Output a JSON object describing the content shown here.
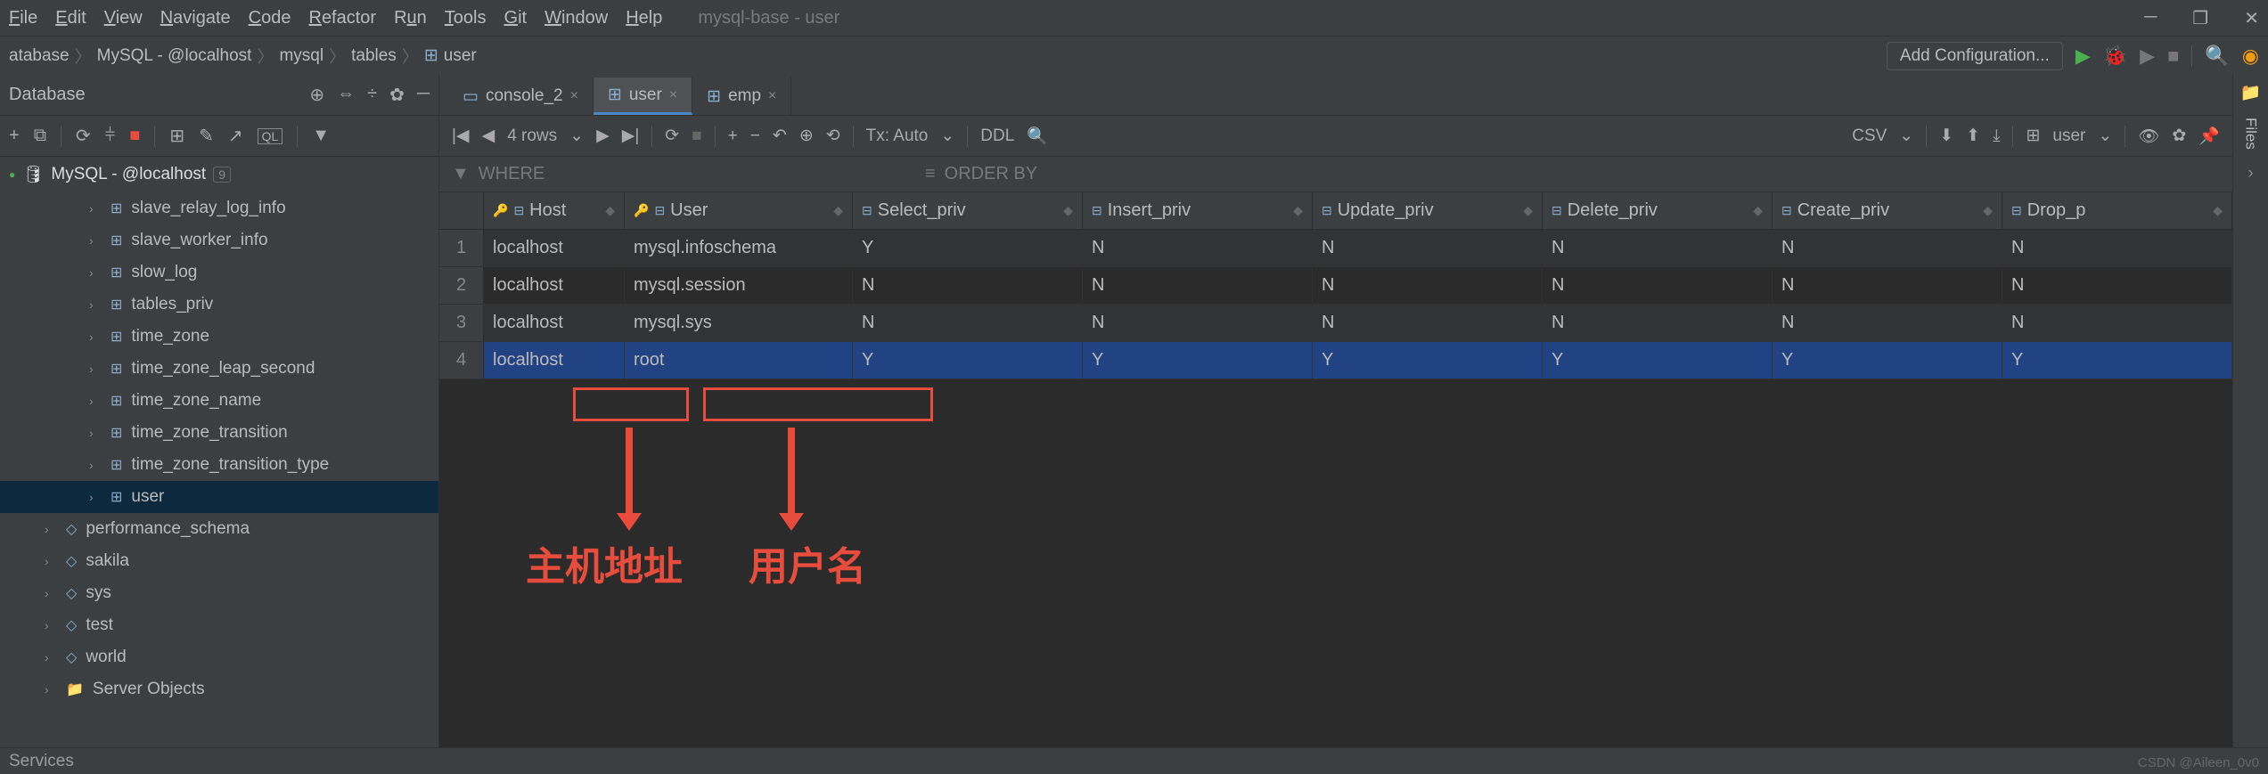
{
  "window_title": "mysql-base - user",
  "menu": [
    "File",
    "Edit",
    "View",
    "Navigate",
    "Code",
    "Refactor",
    "Run",
    "Tools",
    "Git",
    "Window",
    "Help"
  ],
  "breadcrumbs": [
    "atabase",
    "MySQL - @localhost",
    "mysql",
    "tables",
    "user"
  ],
  "add_config": "Add Configuration...",
  "database_panel": {
    "title": "Database",
    "datasource": "MySQL - @localhost",
    "datasource_count": "9"
  },
  "tree_items": [
    {
      "name": "slave_relay_log_info",
      "indent": 2,
      "type": "table"
    },
    {
      "name": "slave_worker_info",
      "indent": 2,
      "type": "table"
    },
    {
      "name": "slow_log",
      "indent": 2,
      "type": "table"
    },
    {
      "name": "tables_priv",
      "indent": 2,
      "type": "table"
    },
    {
      "name": "time_zone",
      "indent": 2,
      "type": "table"
    },
    {
      "name": "time_zone_leap_second",
      "indent": 2,
      "type": "table"
    },
    {
      "name": "time_zone_name",
      "indent": 2,
      "type": "table"
    },
    {
      "name": "time_zone_transition",
      "indent": 2,
      "type": "table"
    },
    {
      "name": "time_zone_transition_type",
      "indent": 2,
      "type": "table"
    },
    {
      "name": "user",
      "indent": 2,
      "type": "table",
      "selected": true
    },
    {
      "name": "performance_schema",
      "indent": 1,
      "type": "schema"
    },
    {
      "name": "sakila",
      "indent": 1,
      "type": "schema"
    },
    {
      "name": "sys",
      "indent": 1,
      "type": "schema"
    },
    {
      "name": "test",
      "indent": 1,
      "type": "schema"
    },
    {
      "name": "world",
      "indent": 1,
      "type": "schema"
    },
    {
      "name": "Server Objects",
      "indent": 1,
      "type": "folder"
    }
  ],
  "tabs": [
    {
      "label": "console_2",
      "icon": "console",
      "active": false
    },
    {
      "label": "user",
      "icon": "table",
      "active": true
    },
    {
      "label": "emp",
      "icon": "table",
      "active": false
    }
  ],
  "toolbar": {
    "row_count": "4 rows",
    "tx_mode": "Tx: Auto",
    "ddl": "DDL",
    "export_fmt": "CSV",
    "view_as": "user"
  },
  "filter": {
    "where_label": "WHERE",
    "orderby_label": "ORDER BY"
  },
  "columns": [
    "Host",
    "User",
    "Select_priv",
    "Insert_priv",
    "Update_priv",
    "Delete_priv",
    "Create_priv",
    "Drop_p"
  ],
  "rows": [
    {
      "num": "1",
      "host": "localhost",
      "user": "mysql.infoschema",
      "select": "Y",
      "insert": "N",
      "update": "N",
      "delete": "N",
      "create": "N",
      "drop": "N"
    },
    {
      "num": "2",
      "host": "localhost",
      "user": "mysql.session",
      "select": "N",
      "insert": "N",
      "update": "N",
      "delete": "N",
      "create": "N",
      "drop": "N"
    },
    {
      "num": "3",
      "host": "localhost",
      "user": "mysql.sys",
      "select": "N",
      "insert": "N",
      "update": "N",
      "delete": "N",
      "create": "N",
      "drop": "N"
    },
    {
      "num": "4",
      "host": "localhost",
      "user": "root",
      "select": "Y",
      "insert": "Y",
      "update": "Y",
      "delete": "Y",
      "create": "Y",
      "drop": "Y",
      "selected": true
    }
  ],
  "annotations": {
    "host_label": "主机地址",
    "user_label": "用户名"
  },
  "statusbar": "Services",
  "side_tab": "Files",
  "watermark": "CSDN @Aileen_0v0"
}
